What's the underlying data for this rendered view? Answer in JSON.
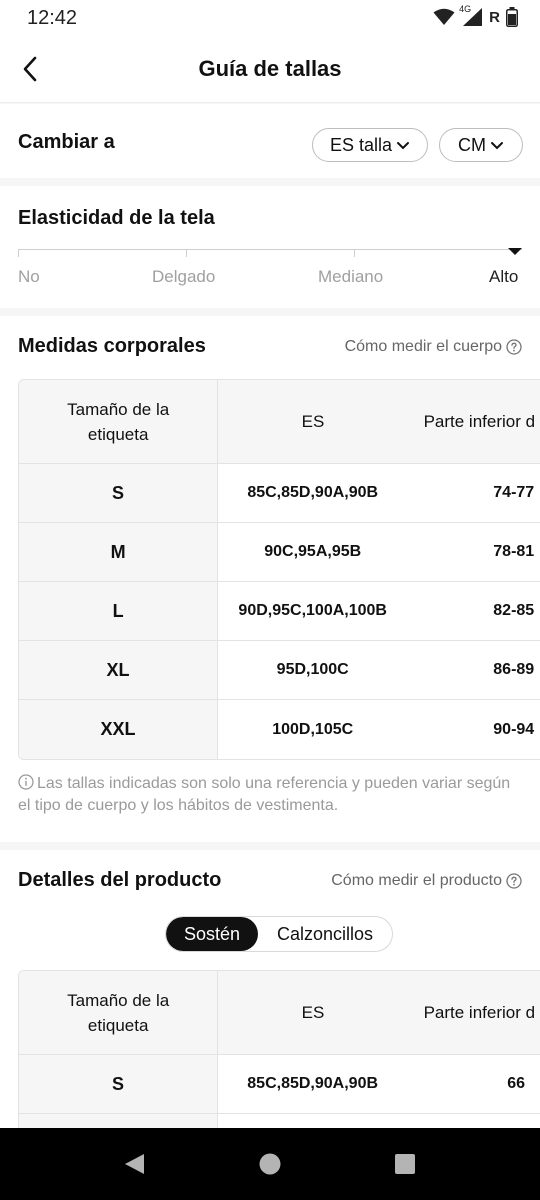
{
  "status_bar": {
    "time": "12:42",
    "network": "4G",
    "roaming": "R"
  },
  "header": {
    "title": "Guía de tallas"
  },
  "convert": {
    "label": "Cambiar a",
    "size_system": "ES talla",
    "unit": "CM"
  },
  "elasticity": {
    "title": "Elasticidad de la tela",
    "levels": [
      "No",
      "Delgado",
      "Mediano",
      "Alto"
    ],
    "selected": "Alto"
  },
  "body_measurements": {
    "title": "Medidas corporales",
    "how_to_link": "Cómo medir el cuerpo",
    "columns": [
      "Tamaño de la etiqueta",
      "ES",
      "Parte inferior d"
    ],
    "rows": [
      [
        "S",
        "85C,85D,90A,90B",
        "74-77"
      ],
      [
        "M",
        "90C,95A,95B",
        "78-81"
      ],
      [
        "L",
        "90D,95C,100A,100B",
        "82-85"
      ],
      [
        "XL",
        "95D,100C",
        "86-89"
      ],
      [
        "XXL",
        "100D,105C",
        "90-94"
      ]
    ],
    "note": "Las tallas indicadas son solo una referencia y pueden variar según el tipo de cuerpo y los hábitos de vestimenta."
  },
  "product_details": {
    "title": "Detalles del producto",
    "how_to_link": "Cómo medir el producto",
    "tabs": [
      "Sostén",
      "Calzoncillos"
    ],
    "active_tab": "Sostén",
    "columns": [
      "Tamaño de la etiqueta",
      "ES",
      "Parte inferior d"
    ],
    "rows": [
      [
        "S",
        "85C,85D,90A,90B",
        "66"
      ]
    ]
  }
}
